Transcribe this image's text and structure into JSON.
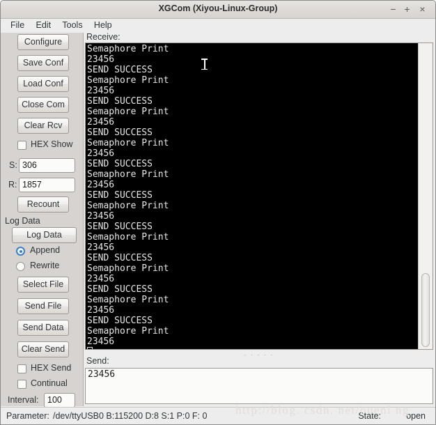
{
  "window": {
    "title": "XGCom (Xiyou-Linux-Group)",
    "minimize_label": "−",
    "maximize_label": "+",
    "close_label": "×"
  },
  "menubar": {
    "items": [
      {
        "label": "File"
      },
      {
        "label": "Edit"
      },
      {
        "label": "Tools"
      },
      {
        "label": "Help"
      }
    ]
  },
  "sidebar": {
    "buttons": {
      "configure": "Configure",
      "save_conf": "Save Conf",
      "load_conf": "Load Conf",
      "close_com": "Close Com",
      "clear_rcv": "Clear Rcv",
      "recount": "Recount",
      "log_data": "Log Data",
      "select_file": "Select File",
      "send_file": "Send File",
      "send_data": "Send Data",
      "clear_send": "Clear Send"
    },
    "hex_show_label": "HEX Show",
    "hex_show_checked": false,
    "sent_label": "S:",
    "sent_value": "306",
    "recv_label": "R:",
    "recv_value": "1857",
    "log_data_group_label": "Log Data",
    "append_label": "Append",
    "append_checked": true,
    "rewrite_label": "Rewrite",
    "rewrite_checked": false,
    "hex_send_label": "HEX Send",
    "hex_send_checked": false,
    "continual_label": "Continual",
    "continual_checked": false,
    "interval_label": "Interval:",
    "interval_value": "100"
  },
  "main": {
    "receive_label": "Receive:",
    "send_label": "Send:",
    "send_value": "23456",
    "splitter_dots": "· · · · ·",
    "terminal_lines": [
      "Semaphore Print",
      "23456",
      "SEND SUCCESS",
      "Semaphore Print",
      "23456",
      "SEND SUCCESS",
      "Semaphore Print",
      "23456",
      "SEND SUCCESS",
      "Semaphore Print",
      "23456",
      "SEND SUCCESS",
      "Semaphore Print",
      "23456",
      "SEND SUCCESS",
      "Semaphore Print",
      "23456",
      "SEND SUCCESS",
      "Semaphore Print",
      "23456",
      "SEND SUCCESS",
      "Semaphore Print",
      "23456",
      "SEND SUCCESS",
      "Semaphore Print",
      "23456",
      "SEND SUCCESS",
      "Semaphore Print",
      "23456"
    ]
  },
  "statusbar": {
    "parameter_label": "Parameter:",
    "parameter_value": "/dev/ttyUSB0 B:115200 D:8 S:1 P:0 F: 0",
    "state_label": "State:",
    "state_value": "open"
  },
  "watermark": {
    "text": "http://blog. csdn. net/oueni ng"
  },
  "colors": {
    "window_bg": "#ededed",
    "sidebar_bg": "#d6d3d0",
    "terminal_bg": "#000000",
    "terminal_fg": "#e8e8e8",
    "accent": "#3b7fc4"
  }
}
